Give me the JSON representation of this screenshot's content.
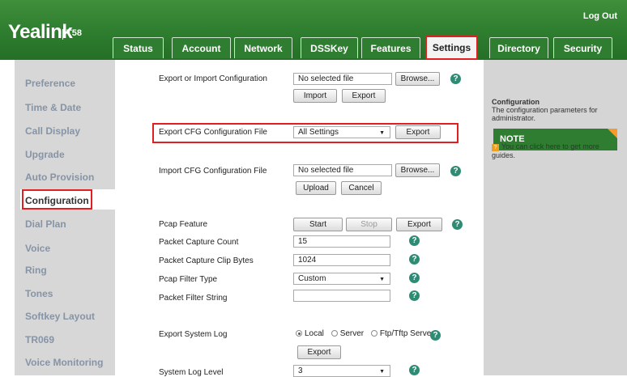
{
  "header": {
    "logo": "Yealink",
    "model": "T58",
    "logout": "Log Out",
    "tabs": [
      {
        "label": "Status"
      },
      {
        "label": "Account"
      },
      {
        "label": "Network"
      },
      {
        "label": "DSSKey"
      },
      {
        "label": "Features"
      },
      {
        "label": "Settings",
        "active": true
      },
      {
        "label": "Directory"
      },
      {
        "label": "Security"
      }
    ]
  },
  "sidebar": {
    "items": [
      {
        "label": "Preference"
      },
      {
        "label": "Time & Date"
      },
      {
        "label": "Call Display"
      },
      {
        "label": "Upgrade"
      },
      {
        "label": "Auto Provision"
      },
      {
        "label": "Configuration",
        "active": true
      },
      {
        "label": "Dial Plan"
      },
      {
        "label": "Voice"
      },
      {
        "label": "Ring"
      },
      {
        "label": "Tones"
      },
      {
        "label": "Softkey Layout"
      },
      {
        "label": "TR069"
      },
      {
        "label": "Voice Monitoring"
      }
    ]
  },
  "main": {
    "export_import": {
      "label": "Export or Import Configuration",
      "file_value": "No selected file",
      "browse": "Browse...",
      "import": "Import",
      "export": "Export"
    },
    "export_cfg": {
      "label": "Export CFG Configuration File",
      "selected": "All Settings",
      "export": "Export"
    },
    "import_cfg": {
      "label": "Import CFG Configuration File",
      "file_value": "No selected file",
      "browse": "Browse...",
      "upload": "Upload",
      "cancel": "Cancel"
    },
    "pcap": {
      "label": "Pcap Feature",
      "start": "Start",
      "stop": "Stop",
      "export": "Export"
    },
    "capture_count": {
      "label": "Packet Capture Count",
      "value": "15"
    },
    "clip_bytes": {
      "label": "Packet Capture Clip Bytes",
      "value": "1024"
    },
    "filter_type": {
      "label": "Pcap Filter Type",
      "selected": "Custom"
    },
    "filter_string": {
      "label": "Packet Filter String",
      "value": ""
    },
    "system_log": {
      "label": "Export System Log",
      "options": [
        "Local",
        "Server",
        "Ftp/Tftp Server"
      ],
      "selected": "Local",
      "export": "Export"
    },
    "log_level": {
      "label": "System Log Level",
      "selected": "3"
    },
    "help_glyph": "?"
  },
  "note": {
    "title": "NOTE",
    "heading": "Configuration",
    "text": "The configuration parameters for administrator.",
    "guide": "You can click here to get more guides.",
    "guide_icon": "?"
  },
  "colors": {
    "header_green": "#2e7d2f",
    "highlight_red": "#e02020",
    "help_teal": "#2f8c74",
    "note_accent": "#f59c2a"
  }
}
